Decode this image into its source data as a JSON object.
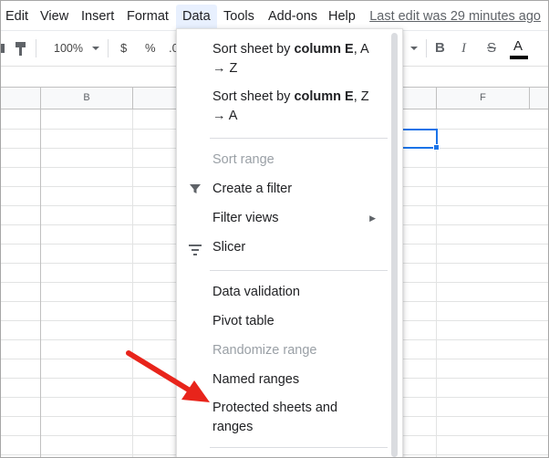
{
  "menubar": {
    "items": [
      "Edit",
      "View",
      "Insert",
      "Format",
      "Data",
      "Tools",
      "Add-ons",
      "Help"
    ],
    "last_edit": "Last edit was 29 minutes ago"
  },
  "toolbar": {
    "zoom": "100%",
    "currency": "$",
    "percent": "%",
    "decimal": ".0",
    "bold": "B",
    "italic": "I",
    "strikethrough": "S",
    "text_color": "A",
    "text_color_swatch": "#000000"
  },
  "grid": {
    "columns": [
      "B",
      "F"
    ]
  },
  "data_menu": {
    "sort_asc": {
      "prefix": "Sort sheet by ",
      "bold": "column E",
      "suffix": ", A",
      "line2": "→ Z"
    },
    "sort_desc": {
      "prefix": "Sort sheet by ",
      "bold": "column E",
      "suffix": ", Z",
      "line2": "→ A"
    },
    "sort_range": "Sort range",
    "create_filter": "Create a filter",
    "filter_views": "Filter views",
    "slicer": "Slicer",
    "data_validation": "Data validation",
    "pivot_table": "Pivot table",
    "randomize_range": "Randomize range",
    "named_ranges": "Named ranges",
    "protected_line1": "Protected sheets and",
    "protected_line2": "ranges"
  },
  "colors": {
    "accent": "#1a73e8",
    "arrow": "#e8241b",
    "disabled_text": "#9aa0a6",
    "menu_active_bg": "#e8f0fe"
  }
}
